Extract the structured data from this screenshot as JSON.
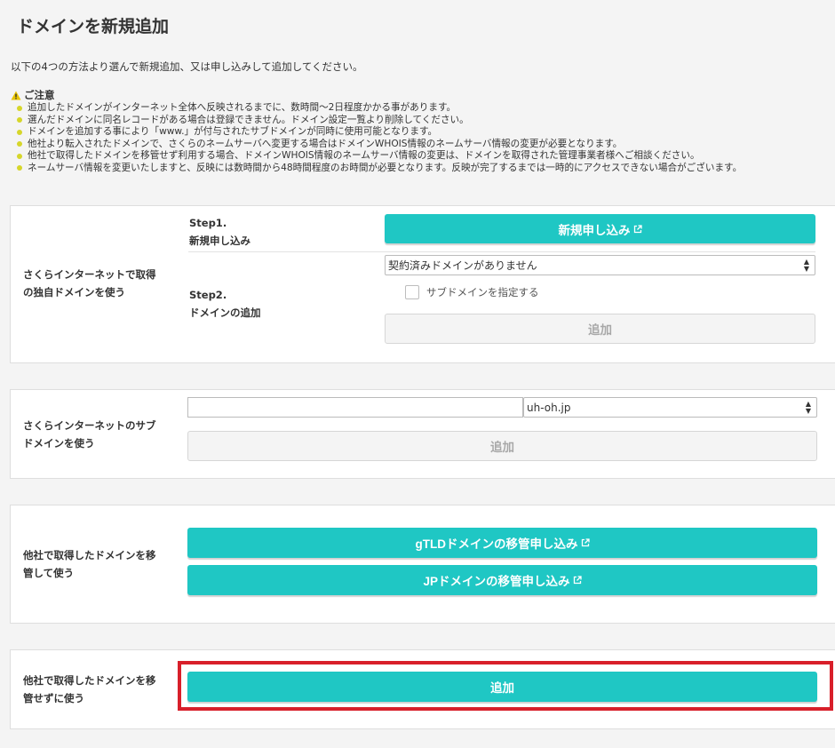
{
  "page": {
    "title": "ドメインを新規追加",
    "intro": "以下の4つの方法より選んで新規追加、又は申し込みして追加してください。"
  },
  "notice": {
    "heading": "ご注意",
    "items": [
      "追加したドメインがインターネット全体へ反映されるまでに、数時間〜2日程度かかる事があります。",
      "選んだドメインに同名レコードがある場合は登録できません。ドメイン設定一覧より削除してください。",
      "ドメインを追加する事により「www.」が付与されたサブドメインが同時に使用可能となります。",
      "他社より転入されたドメインで、さくらのネームサーバへ変更する場合はドメインWHOIS情報のネームサーバ情報の変更が必要となります。",
      "他社で取得したドメインを移管せず利用する場合、ドメインWHOIS情報のネームサーバ情報の変更は、ドメインを取得された管理事業者様へご相談ください。",
      "ネームサーバ情報を変更いたしますと、反映には数時間から48時間程度のお時間が必要となります。反映が完了するまでは一時的にアクセスできない場合がございます。"
    ]
  },
  "section1": {
    "label_line1": "さくらインターネットで取得",
    "label_line2": "の独自ドメインを使う",
    "step1_title": "Step1.",
    "step1_sub": "新規申し込み",
    "step1_button": "新規申し込み",
    "step2_title": "Step2.",
    "step2_sub": "ドメインの追加",
    "domain_select": "契約済みドメインがありません",
    "subdomain_checkbox": "サブドメインを指定する",
    "add_button": "追加"
  },
  "section2": {
    "label_line1": "さくらインターネットのサブ",
    "label_line2": "ドメインを使う",
    "subdomain_value": "",
    "domain_select": "uh-oh.jp",
    "add_button": "追加"
  },
  "section3": {
    "label_line1": "他社で取得したドメインを移",
    "label_line2": "管して使う",
    "gtld_button": "gTLDドメインの移管申し込み",
    "jp_button": "JPドメインの移管申し込み"
  },
  "section4": {
    "label_line1": "他社で取得したドメインを移",
    "label_line2": "管せずに使う",
    "add_button": "追加"
  },
  "colors": {
    "accent": "#1fc7c4",
    "highlight": "#d81f2a",
    "warning": "#e8c400",
    "bullet": "#d6d62a"
  },
  "icons": {
    "warning": "warning-triangle-icon",
    "external": "external-link-icon",
    "select_arrow": "updown-arrow-icon"
  }
}
